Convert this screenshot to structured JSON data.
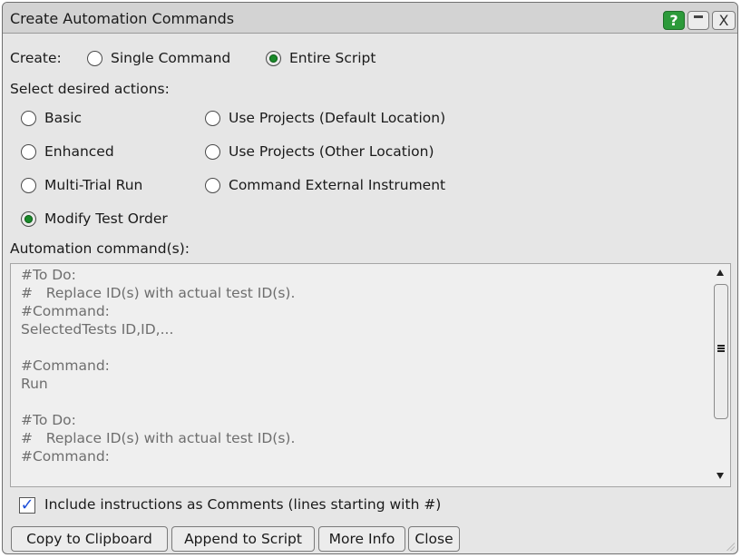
{
  "window": {
    "title": "Create Automation Commands",
    "help_label": "?",
    "close_label": "X"
  },
  "create": {
    "label": "Create:",
    "single_label": "Single Command",
    "script_label": "Entire Script",
    "selected": "Entire Script"
  },
  "actions": {
    "label": "Select desired actions:",
    "items": [
      {
        "label": "Basic",
        "selected": false
      },
      {
        "label": "Use Projects (Default Location)",
        "selected": false
      },
      {
        "label": "Enhanced",
        "selected": false
      },
      {
        "label": "Use Projects (Other Location)",
        "selected": false
      },
      {
        "label": "Multi-Trial Run",
        "selected": false
      },
      {
        "label": "Command External Instrument",
        "selected": false
      },
      {
        "label": "Modify Test Order",
        "selected": true
      }
    ]
  },
  "commands": {
    "label": "Automation command(s):",
    "text": "#To Do:\n#   Replace ID(s) with actual test ID(s).\n#Command:\nSelectedTests ID,ID,...\n\n#Command:\nRun\n\n#To Do:\n#   Replace ID(s) with actual test ID(s).\n#Command:"
  },
  "comments_option": {
    "label": "Include instructions as Comments (lines starting with #)",
    "checked": true,
    "check_glyph": "✓"
  },
  "buttons": {
    "copy": "Copy to Clipboard",
    "append": "Append to Script",
    "more_info": "More Info",
    "close": "Close"
  },
  "colors": {
    "radio_selected": "#1a8a2a",
    "help_button": "#2c9a3a",
    "checkmark": "#1e4fd8"
  }
}
